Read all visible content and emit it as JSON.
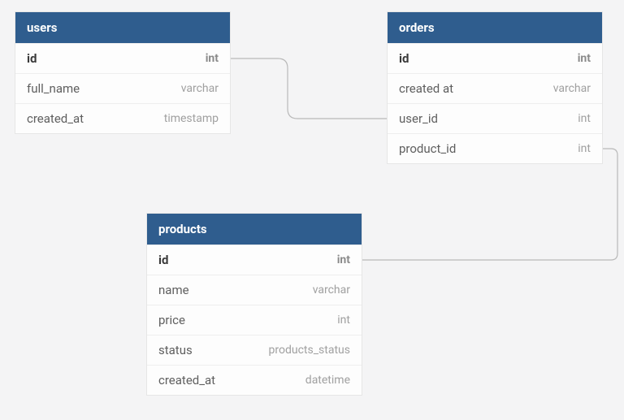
{
  "colors": {
    "header_bg": "#2f5d8e",
    "connector": "#b9b9b9"
  },
  "tables": {
    "users": {
      "title": "users",
      "columns": [
        {
          "name": "id",
          "type": "int",
          "pk": true
        },
        {
          "name": "full_name",
          "type": "varchar",
          "pk": false
        },
        {
          "name": "created_at",
          "type": "timestamp",
          "pk": false
        }
      ]
    },
    "orders": {
      "title": "orders",
      "columns": [
        {
          "name": "id",
          "type": "int",
          "pk": true
        },
        {
          "name": "created at",
          "type": "varchar",
          "pk": false
        },
        {
          "name": "user_id",
          "type": "int",
          "pk": false
        },
        {
          "name": "product_id",
          "type": "int",
          "pk": false
        }
      ]
    },
    "products": {
      "title": "products",
      "columns": [
        {
          "name": "id",
          "type": "int",
          "pk": true
        },
        {
          "name": "name",
          "type": "varchar",
          "pk": false
        },
        {
          "name": "price",
          "type": "int",
          "pk": false
        },
        {
          "name": "status",
          "type": "products_status",
          "pk": false
        },
        {
          "name": "created_at",
          "type": "datetime",
          "pk": false
        }
      ]
    }
  }
}
